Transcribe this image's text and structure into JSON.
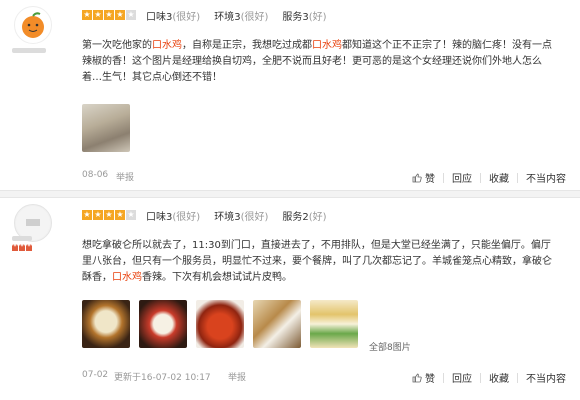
{
  "reviews": [
    {
      "ratings": [
        {
          "label": "口味",
          "value": "3",
          "grade": "(很好)"
        },
        {
          "label": "环境",
          "value": "3",
          "grade": "(很好)"
        },
        {
          "label": "服务",
          "value": "3",
          "grade": "(好)"
        }
      ],
      "stars": 4,
      "text": {
        "p1": "第一次吃他家的",
        "h1": "口水鸡",
        "p2": "，自称是正宗，我想吃过成都",
        "h2": "口水鸡",
        "p3": "都知道这个正不正宗了！辣的脑仁疼！没有一点辣椒的香！这个图片是经理给换自切鸡，全肥不说而且好老！更可恶的是这个女经理还说你们外地人怎么着…生气！其它点心倒还不错！"
      },
      "footer": {
        "date": "08-06",
        "report": "举报"
      },
      "actions": {
        "like": "赞",
        "reply": "回应",
        "fav": "收藏",
        "report": "不当内容"
      }
    },
    {
      "ratings": [
        {
          "label": "口味",
          "value": "3",
          "grade": "(很好)"
        },
        {
          "label": "环境",
          "value": "3",
          "grade": "(很好)"
        },
        {
          "label": "服务",
          "value": "2",
          "grade": "(好)"
        }
      ],
      "stars": 4,
      "text": {
        "p1": "想吃拿破仑所以就去了，11:30到门口，直接进去了，不用排队，但是大堂已经坐满了，只能坐偏厅。偏厅里八张台，但只有一个服务员，明显忙不过来，要个餐牌，叫了几次都忘记了。羊城雀笼点心精致，拿破仑酥香，",
        "h1": "口水鸡",
        "p2": "香辣。下次有机会想试试片皮鸭。"
      },
      "all_pics": "全部8图片",
      "footer": {
        "date": "07-02",
        "updated": "更新于16-07-02 10:17",
        "report": "举报"
      },
      "actions": {
        "like": "赞",
        "reply": "回应",
        "fav": "收藏",
        "report": "不当内容"
      }
    }
  ],
  "icons": {
    "avatar1": "orange-avatar-icon",
    "avatar2": "default-avatar-icon",
    "like": "thumbs-up-icon",
    "star": "star-icon"
  },
  "colors": {
    "highlight": "#e8400c",
    "star": "#f5a623",
    "muted": "#999999"
  }
}
